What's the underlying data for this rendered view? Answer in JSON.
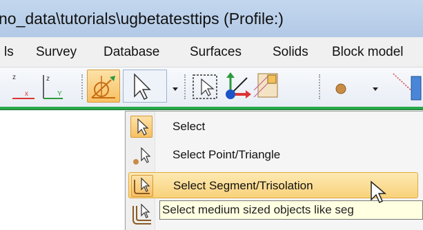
{
  "window": {
    "title": "no_data\\tutorials\\ugbetatesttips (Profile:)"
  },
  "menu": {
    "items": [
      "ls",
      "Survey",
      "Database",
      "Surfaces",
      "Solids",
      "Block model"
    ]
  },
  "toolbar": {
    "buttons": [
      "axis-xz-icon",
      "axis-zy-icon",
      "select-tool-icon",
      "arrow-cursor-icon",
      "dropdown-arrow-icon",
      "select-box-icon",
      "move-axes-icon",
      "grid-icon",
      "sphere-icon",
      "dropdown-arrow-icon",
      "line-icon"
    ]
  },
  "dropdown": {
    "items": [
      {
        "label": "Select",
        "icon": "arrow-icon"
      },
      {
        "label": "Select Point/Triangle",
        "icon": "point-arrow-icon"
      },
      {
        "label": "Select Segment/Trisolation",
        "icon": "segment-arrow-icon",
        "highlighted": true
      },
      {
        "label": "",
        "icon": "object-arrow-icon"
      }
    ]
  },
  "tooltip": {
    "text": "Select medium sized objects like seg"
  },
  "colors": {
    "highlight": "#f9d27a",
    "accent_green": "#29a84a",
    "title_bar": "#b9cfe9"
  }
}
